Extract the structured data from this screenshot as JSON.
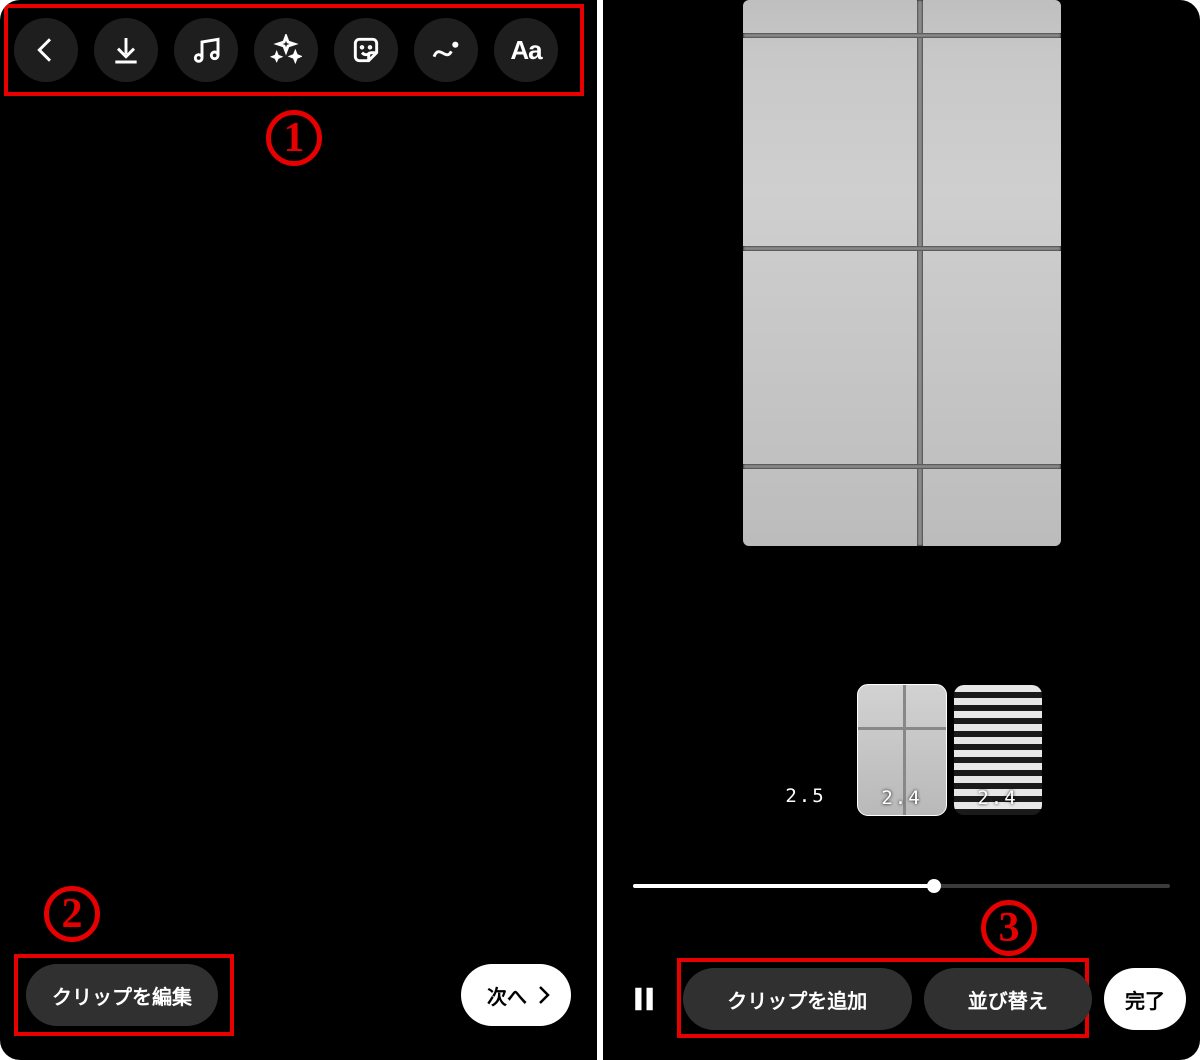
{
  "annotations": {
    "callout_1": "1",
    "callout_2": "2",
    "callout_3": "3"
  },
  "left": {
    "toolbar_icons": {
      "back": "back-icon",
      "download": "download-icon",
      "music": "music-icon",
      "effects": "sparkle-icon",
      "sticker": "sticker-icon",
      "draw": "draw-icon",
      "text": "text-icon",
      "text_label": "Aa"
    },
    "edit_clips_label": "クリップを編集",
    "next_label": "次へ"
  },
  "right": {
    "clip_durations": [
      "2.5",
      "2.4",
      "2.4"
    ],
    "timeline_progress_pct": 56,
    "add_clip_label": "クリップを追加",
    "reorder_label": "並び替え",
    "done_label": "完了"
  }
}
